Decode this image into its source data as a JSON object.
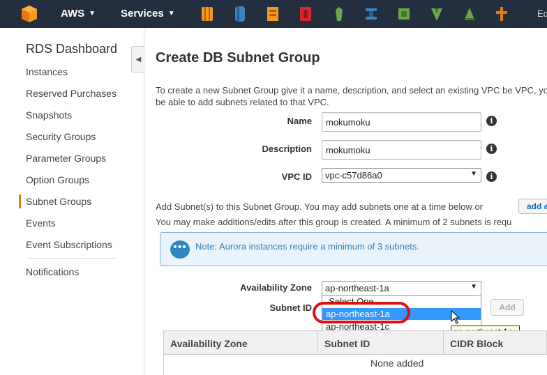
{
  "topbar": {
    "brand": "AWS",
    "services": "Services",
    "right_text": "Ed",
    "icon_names": [
      "ec2-icon",
      "s3-icon",
      "rds-icon",
      "cloudformation-icon",
      "elasticbeanstalk-icon",
      "cloudfront-icon",
      "vpc-icon",
      "lambda-icon",
      "elb-icon",
      "iam-icon"
    ],
    "colors": {
      "bar": "#232f3e",
      "orange": "#e47911"
    }
  },
  "sidebar": {
    "title": "RDS Dashboard",
    "items": [
      {
        "label": "Instances"
      },
      {
        "label": "Reserved Purchases"
      },
      {
        "label": "Snapshots"
      },
      {
        "label": "Security Groups"
      },
      {
        "label": "Parameter Groups"
      },
      {
        "label": "Option Groups"
      },
      {
        "label": "Subnet Groups",
        "active": true
      },
      {
        "label": "Events"
      },
      {
        "label": "Event Subscriptions"
      },
      {
        "label": "Notifications"
      }
    ]
  },
  "main": {
    "title": "Create DB Subnet Group",
    "description": "To create a new Subnet Group give it a name, description, and select an existing VPC be VPC, you will be able to add subnets related to that VPC.",
    "form": {
      "name_label": "Name",
      "name_value": "mokumoku",
      "description_label": "Description",
      "description_value": "mokumoku",
      "vpc_label": "VPC ID",
      "vpc_value": "vpc-c57d86a0"
    },
    "add_line_1": "Add Subnet(s) to this Subnet Group. You may add subnets one at a time below or",
    "add_all_label": "add a",
    "add_line_2": "You may make additions/edits after this group is created. A minimum of 2 subnets is requ",
    "note": "Note: Aurora instances require a minimum of 3 subnets.",
    "az_label": "Availability Zone",
    "az_value": "ap-northeast-1a",
    "az_options": [
      "-Select One-",
      "ap-northeast-1a",
      "ap-northeast-1c"
    ],
    "subnet_label": "Subnet ID",
    "add_button": "Add",
    "tooltip": "ap-northeast-1a",
    "table": {
      "headers": [
        "Availability Zone",
        "Subnet ID",
        "CIDR Block"
      ],
      "empty_text": "None added"
    }
  }
}
